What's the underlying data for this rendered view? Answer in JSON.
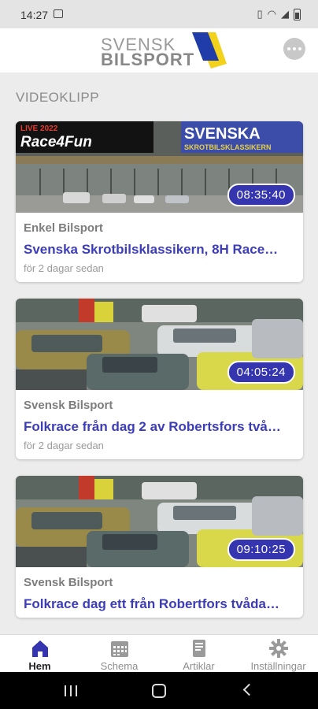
{
  "status_bar": {
    "time": "14:27"
  },
  "header": {
    "logo_line1": "SVENSK",
    "logo_line2": "BILSPORT",
    "brand_colors": {
      "blue": "#1f3ca8",
      "yellow": "#f2d21b"
    }
  },
  "section": {
    "title": "VIDEOKLIPP"
  },
  "videos": [
    {
      "duration": "08:35:40",
      "channel": "Enkel Bilsport",
      "title": "Svenska Skrotbilsklassikern, 8H Race…",
      "when": "för 2 dagar sedan",
      "thumb_banner_left": "Race4Fun",
      "thumb_banner_left_top": "LIVE 2022",
      "thumb_banner_right_1": "SVENSKA",
      "thumb_banner_right_2": "SKROTBILSKLASSIKERN"
    },
    {
      "duration": "04:05:24",
      "channel": "Svensk Bilsport",
      "title": "Folkrace från dag 2 av Robertsfors två…",
      "when": "för 2 dagar sedan"
    },
    {
      "duration": "09:10:25",
      "channel": "Svensk Bilsport",
      "title": "Folkrace dag ett från Robertfors tvåda…",
      "when": ""
    }
  ],
  "bottom_nav": {
    "items": [
      {
        "label": "Hem",
        "icon": "home-icon",
        "active": true
      },
      {
        "label": "Schema",
        "icon": "calendar-icon",
        "active": false
      },
      {
        "label": "Artiklar",
        "icon": "document-icon",
        "active": false
      },
      {
        "label": "Inställningar",
        "icon": "gear-icon",
        "active": false
      }
    ],
    "active_color": "#3535b0"
  },
  "colors": {
    "accent": "#3535b0",
    "title_blue": "#3d3db8"
  }
}
